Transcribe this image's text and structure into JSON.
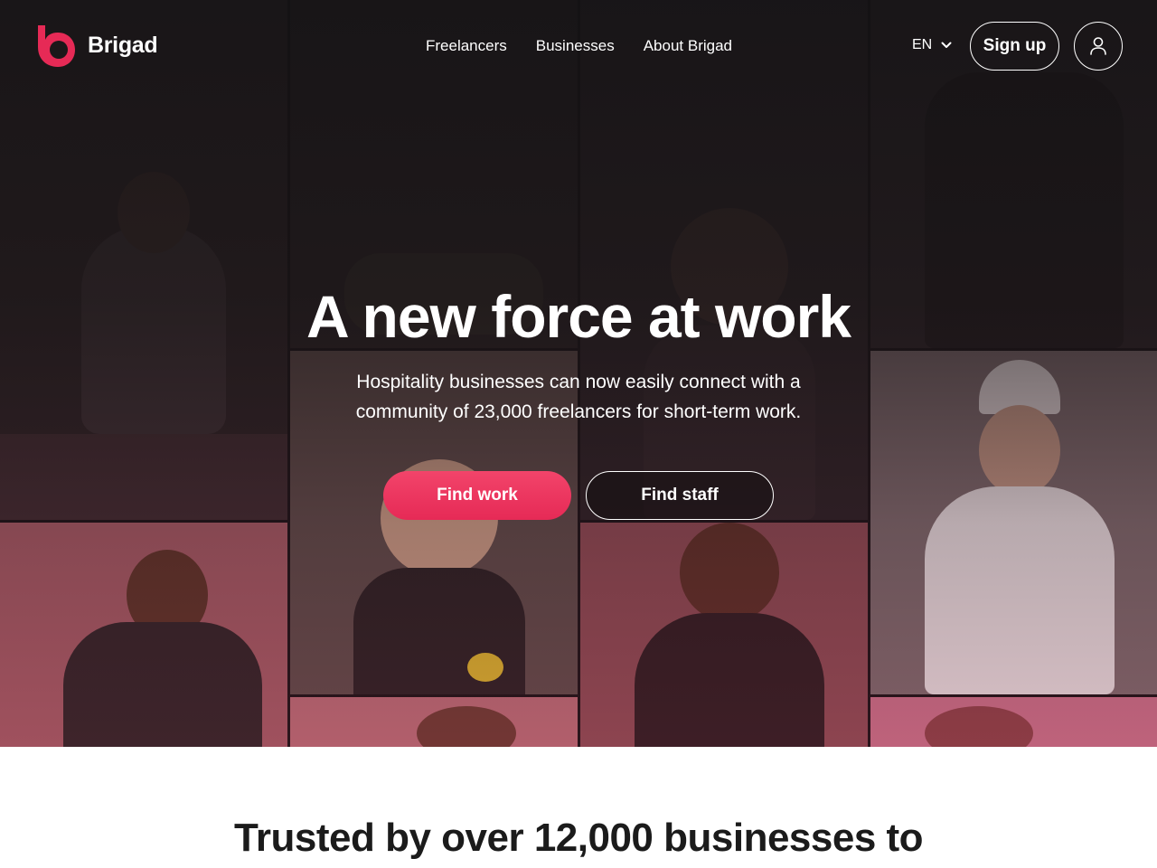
{
  "brand": {
    "name": "Brigad",
    "accent": "#e62a56"
  },
  "nav": {
    "items": [
      {
        "label": "Freelancers"
      },
      {
        "label": "Businesses"
      },
      {
        "label": "About Brigad"
      }
    ]
  },
  "header": {
    "language": "EN",
    "language_icon": "chevron-down-icon",
    "signup_label": "Sign up",
    "account_icon": "user-icon"
  },
  "hero": {
    "title": "A new force at work",
    "subtitle": "Hospitality businesses can now easily connect with a community of 23,000 freelancers for short-term work.",
    "primary_cta": "Find work",
    "secondary_cta": "Find staff"
  },
  "trust": {
    "heading": "Trusted by over 12,000 businesses to"
  }
}
